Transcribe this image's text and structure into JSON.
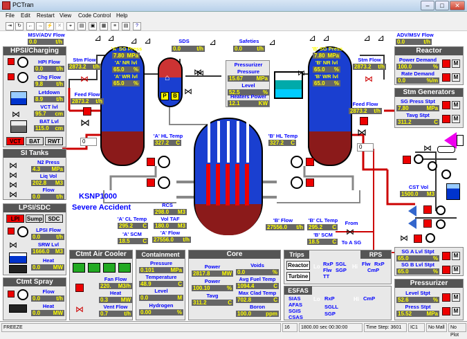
{
  "app": {
    "title": "PCTran"
  },
  "menu": [
    "File",
    "Edit",
    "Restart",
    "View",
    "Code Control",
    "Help"
  ],
  "top": {
    "msv_adv_label": "MSV/ADV Flow",
    "msv_adv_val": "0.0",
    "msv_adv_unit": "t/h",
    "sds_label": "SDS",
    "sds_val": "0.0",
    "sds_unit": "t/h",
    "safeties_label": "Safeties",
    "safeties_val": "0.0",
    "safeties_unit": "t/h",
    "adv_msv_label": "ADV/MSV Flow",
    "adv_msv_val": "0.0",
    "adv_msv_unit": "t/h"
  },
  "hpsi": {
    "title": "HPSI/Charging",
    "hpi_label": "HPI Flow",
    "hpi_val": "0.0",
    "hpi_unit": "t/h",
    "chg_label": "Chg Flow",
    "chg_val": "9.8",
    "chg_unit": "t/h",
    "letdown_label": "Letdown",
    "letdown_val": "8.9",
    "letdown_unit": "t/h",
    "vct_label": "VCT lvl",
    "vct_val": "95.7",
    "vct_unit": "cm",
    "bat_label": "BAT Lvl",
    "bat_val": "115.0",
    "bat_unit": "cm",
    "btn_vct": "VCT",
    "btn_bat": "BAT",
    "btn_rwt": "RWT"
  },
  "si": {
    "title": "SI Tanks",
    "n2_label": "N2 Press",
    "n2_val": "4.3",
    "n2_unit": "MPa",
    "liq_label": "Liq Vol",
    "liq_val": "202.8",
    "liq_unit": "M3",
    "flow_label": "Flow",
    "flow_val": "0.0",
    "flow_unit": "t/h"
  },
  "lpsi": {
    "title": "LPSI/SDC",
    "btn_lpi": "LPI",
    "btn_sump": "Sump",
    "btn_sdc": "SDC",
    "lpsi_label": "LPSI Flow",
    "lpsi_val": "0.0",
    "lpsi_unit": "t/h",
    "srw_label": "SRW Lvl",
    "srw_val": "1666.0",
    "srw_unit": "M3",
    "heat_label": "Heat",
    "heat_val": "0.0",
    "heat_unit": "MW"
  },
  "spray": {
    "title": "Ctmt Spray",
    "flow_label": "Flow",
    "flow_val": "0.0",
    "flow_unit": "t/h",
    "heat_label": "Heat",
    "heat_val": "0.0",
    "heat_unit": "MW"
  },
  "cooler": {
    "title": "Ctmt Air Cooler",
    "fan_label": "Fan Flow",
    "fan_val": "220.",
    "fan_unit": "M3/h",
    "heat_label": "Heat",
    "heat_val": "0.3",
    "heat_unit": "MW",
    "vent_label": "Vent Flow",
    "vent_val": "0.7",
    "vent_unit": "t/h"
  },
  "ctmt": {
    "title": "Containment",
    "press_label": "Pressure",
    "press_val": "0.101",
    "press_unit": "MPa",
    "temp_label": "Temperature",
    "temp_val": "48.9",
    "temp_unit": "C",
    "level_label": "Level",
    "level_val": "0.0",
    "level_unit": "M",
    "h2_label": "Hydrogen",
    "h2_val": "0.00",
    "h2_unit": "%"
  },
  "core": {
    "title": "Core",
    "power_label": "Power",
    "power_val": "2817.8",
    "power_unit": "MW",
    "power2_label": "Power",
    "power2_val": "100.10",
    "power2_unit": "%",
    "tavg_label": "Tavg",
    "tavg_val": "311.2",
    "tavg_unit": "C",
    "voids_label": "Voids",
    "voids_val": "0.0",
    "voids_unit": "%",
    "avgfuel_label": "Avg Fuel Temp",
    "avgfuel_val": "1094.4",
    "avgfuel_unit": "C",
    "maxclad_label": "Max Clad Temp",
    "maxclad_val": "702.8",
    "maxclad_unit": "C",
    "boron_label": "Boron",
    "boron_val": "100.0",
    "boron_unit": "ppm"
  },
  "trips": {
    "title": "Trips",
    "reactor": "Reactor",
    "turbine": "Turbine",
    "lo": "Lo",
    "rxp": "RxP",
    "ttflw": "Flw",
    "tt": "TT",
    "sgl": "SGL",
    "sgp": "SGP",
    "hi": "Hi",
    "flw": "Flw",
    "rxp2": "RxP",
    "cmp": "CmP",
    "rps_title": "RPS"
  },
  "esfas": {
    "title": "ESFAS",
    "sias": "SIAS",
    "afas": "AFAS",
    "sgis": "SGIS",
    "csas": "CSAS",
    "lo": "Lo",
    "rxp": "RxP",
    "sgl": "SGLL",
    "sgp": "SGP",
    "hi": "Hi",
    "cmp": "CmP"
  },
  "reactor": {
    "title": "Reactor",
    "pd_label": "Power Demand",
    "pd_val": "100.0",
    "pd_unit": "%",
    "rd_label": "Rate Demand",
    "rd_val": "0.0",
    "rd_unit": "%/m"
  },
  "sg": {
    "title": "Stm Generators",
    "sp_label": "SG Press Stpt",
    "sp_val": "7.80",
    "sp_unit": "MPa",
    "tavg_label": "Tavg Stpt",
    "tavg_val": "311.2",
    "tavg_unit": "C",
    "cst_label": "CST Vol",
    "cst_val": "1500.0",
    "cst_unit": "M3",
    "sga_label": "SG A Lvl Stpt",
    "sga_val": "65.0",
    "sga_unit": "%",
    "sgb_label": "SG B Lvl Stpt",
    "sgb_val": "65.0",
    "sgb_unit": "%"
  },
  "przr_stpt": {
    "title": "Pressurizer",
    "level_label": "Level Stpt",
    "level_val": "52.6",
    "level_unit": "%",
    "press_label": "Press Stpt",
    "press_val": "15.52",
    "press_unit": "MPa"
  },
  "plant": {
    "asg_press_label": "'A' SG Press",
    "asg_press_val": "7.80",
    "asg_press_unit": "MPa",
    "anr_label": "'A' NR lvl",
    "anr_val": "65.0",
    "anr_unit": "%",
    "awr_label": "'A' WR lvl",
    "awr_val": "65.0",
    "awr_unit": "%",
    "bsg_press_label": "'B' SG Press",
    "bsg_press_val": "7.80",
    "bsg_press_unit": "MPa",
    "bnr_label": "'B' NR lvl",
    "bnr_val": "65.0",
    "bnr_unit": "%",
    "bwr_label": "'B' WR lvl",
    "bwr_val": "65.0",
    "bwr_unit": "%",
    "astm_label": "Stm Flow",
    "astm_val": "2873.2",
    "astm_unit": "t/h",
    "bstm_label": "Stm Flow",
    "bstm_val": "2873.2",
    "bstm_unit": "t/h",
    "afeed_label": "Feed Flow",
    "afeed_val": "2873.2",
    "afeed_unit": "t/h",
    "bfeed_label": "Feed Flow",
    "bfeed_val": "2873.2",
    "bfeed_unit": "t/h",
    "spin_a": "0",
    "spin_b": "0",
    "przr_label": "Pressurizer",
    "press_label": "Pressure",
    "press_val": "15.67",
    "press_unit": "MPa",
    "level_label": "Level",
    "level_val": "52.5",
    "level_unit": "%",
    "heaters_label": "Heaters Power",
    "heaters_val": "12.1",
    "heaters_unit": "KW",
    "p": "P",
    "b": "B",
    "ahl_label": "'A' HL Temp",
    "ahl_val": "327.2",
    "ahl_unit": "C",
    "bhl_label": "'B' HL Temp",
    "bhl_val": "327.2",
    "bhl_unit": "C",
    "plant_name": "KSNP1000",
    "accident": "Severe Accident",
    "rcs_label": "RCS",
    "rcs_val": "298.0",
    "rcs_unit": "M3",
    "vtaf_label": "Vol TAF",
    "vtaf_val": "180.0",
    "vtaf_unit": "M3",
    "aflow_label": "'A' Flow",
    "aflow_val": "27556.0",
    "aflow_unit": "t/h",
    "acl_label": "'A' CL Temp",
    "acl_val": "295.2",
    "acl_unit": "C",
    "ascm_label": "'A' SCM",
    "ascm_val": "18.5",
    "ascm_unit": "C",
    "bflow_label": "'B' Flow",
    "bflow_val": "27556.0",
    "bflow_unit": "t/h",
    "bcl_label": "'B' CL Temp",
    "bcl_val": "295.2",
    "bcl_unit": "C",
    "bscm_label": "'B' SCM",
    "bscm_val": "18.5",
    "bscm_unit": "C",
    "from": "From",
    "to_sg": "To A SG"
  },
  "status": {
    "mode": "FREEZE",
    "n": "16",
    "time": "1800.00 sec 00:30:00",
    "step": "Time Step: 3601",
    "ic": "IC1",
    "mall": "No Mall",
    "plot": "No Plot"
  },
  "colors": {
    "accent": "#0000ff",
    "value_bg": "#666666",
    "value_fg": "#ffff00",
    "vessel": "#1a3fd0",
    "lower": "#8b1a1a"
  }
}
